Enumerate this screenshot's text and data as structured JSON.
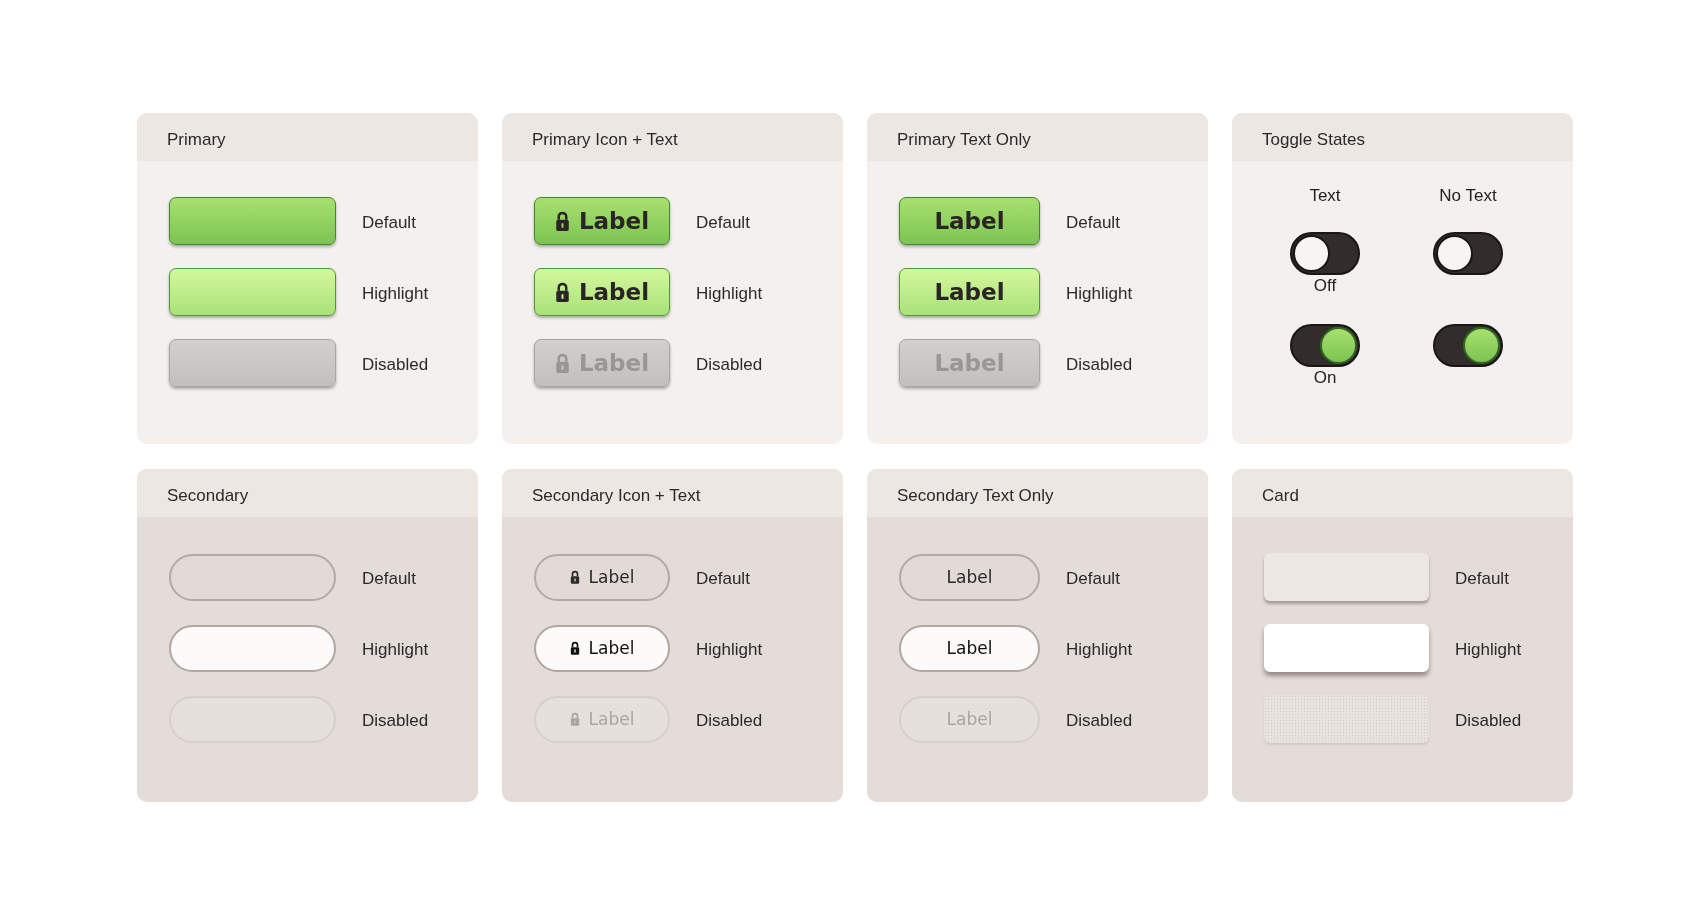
{
  "panels": [
    {
      "title": "Primary",
      "kind": "primary",
      "rows": [
        {
          "highlighted": false,
          "disabled": false,
          "caption": "Default"
        },
        {
          "highlighted": true,
          "disabled": false,
          "caption": "Highlight"
        },
        {
          "highlighted": false,
          "disabled": true,
          "caption": "Disabled"
        }
      ]
    },
    {
      "title": "Primary Icon + Text",
      "kind": "primary",
      "rows": [
        {
          "highlighted": false,
          "disabled": false,
          "icon": true,
          "label": "Label",
          "caption": "Default"
        },
        {
          "highlighted": true,
          "disabled": false,
          "icon": true,
          "label": "Label",
          "caption": "Highlight"
        },
        {
          "highlighted": false,
          "disabled": true,
          "icon": true,
          "label": "Label",
          "caption": "Disabled"
        }
      ]
    },
    {
      "title": "Primary Text Only",
      "kind": "primary",
      "rows": [
        {
          "highlighted": false,
          "disabled": false,
          "label": "Label",
          "caption": "Default"
        },
        {
          "highlighted": true,
          "disabled": false,
          "label": "Label",
          "caption": "Highlight"
        },
        {
          "highlighted": false,
          "disabled": true,
          "label": "Label",
          "caption": "Disabled"
        }
      ]
    },
    {
      "title": "Toggle States",
      "kind": "toggles",
      "columns": [
        {
          "heading": "Text",
          "toggles": [
            {
              "on": false,
              "caption": "Off"
            },
            {
              "on": true,
              "caption": "On"
            }
          ]
        },
        {
          "heading": "No Text",
          "toggles": [
            {
              "on": false
            },
            {
              "on": true
            }
          ]
        }
      ]
    },
    {
      "title": "Secondary",
      "kind": "secondary",
      "rows": [
        {
          "highlighted": false,
          "disabled": false,
          "caption": "Default"
        },
        {
          "highlighted": true,
          "disabled": false,
          "caption": "Highlight"
        },
        {
          "highlighted": false,
          "disabled": true,
          "caption": "Disabled"
        }
      ]
    },
    {
      "title": "Secondary Icon + Text",
      "kind": "secondary",
      "rows": [
        {
          "highlighted": false,
          "disabled": false,
          "icon": true,
          "label": "Label",
          "caption": "Default"
        },
        {
          "highlighted": true,
          "disabled": false,
          "icon": true,
          "label": "Label",
          "caption": "Highlight"
        },
        {
          "highlighted": false,
          "disabled": true,
          "icon": true,
          "label": "Label",
          "caption": "Disabled"
        }
      ]
    },
    {
      "title": "Secondary Text Only",
      "kind": "secondary",
      "rows": [
        {
          "highlighted": false,
          "disabled": false,
          "label": "Label",
          "caption": "Default"
        },
        {
          "highlighted": true,
          "disabled": false,
          "label": "Label",
          "caption": "Highlight"
        },
        {
          "highlighted": false,
          "disabled": true,
          "label": "Label",
          "caption": "Disabled"
        }
      ]
    },
    {
      "title": "Card",
      "kind": "card",
      "rows": [
        {
          "highlighted": false,
          "disabled": false,
          "caption": "Default"
        },
        {
          "highlighted": true,
          "disabled": false,
          "caption": "Highlight"
        },
        {
          "highlighted": false,
          "disabled": true,
          "caption": "Disabled"
        }
      ]
    }
  ]
}
